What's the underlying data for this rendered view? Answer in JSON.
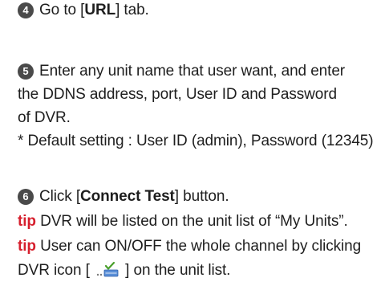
{
  "steps": [
    {
      "number": "4",
      "pre": "Go to [",
      "bold": "URL",
      "post": "] tab."
    },
    {
      "number": "5",
      "line1": "Enter any unit name that user want, and enter",
      "line2": "the DDNS address, port, User ID and Password",
      "line3": "of DVR.",
      "note": "* Default setting : User ID (admin), Password (12345)"
    },
    {
      "number": "6",
      "pre": "Click [",
      "bold": "Connect Test",
      "post": "] button."
    }
  ],
  "tips": [
    {
      "label": "tip",
      "text": " DVR will be listed on the unit list of “My Units”."
    },
    {
      "label": "tip",
      "line1": " User can ON/OFF the whole channel by clicking",
      "line2_pre": "DVR icon [ ",
      "line2_post": " ] on the unit list."
    }
  ],
  "icons": {
    "dvr": "dvr-icon",
    "step_badge": "number-circle"
  },
  "colors": {
    "tip": "#d6202e",
    "badge": "#4a4a4a",
    "check": "#4aa02c"
  }
}
